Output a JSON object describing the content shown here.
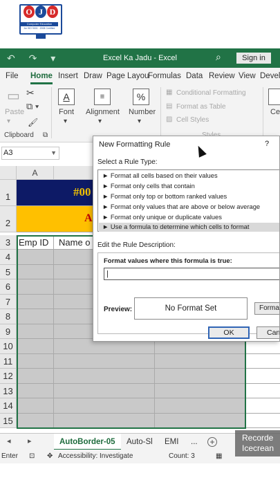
{
  "logo": {
    "letters": [
      "O",
      "J",
      "D"
    ],
    "band": "Computer Education",
    "iso": "An ISO 9001 : 2008 Certified"
  },
  "titlebar": {
    "qat": "↶ ↷ ▾",
    "title": "Excel Ka Jadu  -  Excel",
    "search_icon": "⌕",
    "signin": "Sign in"
  },
  "tabs": [
    "File",
    "Home",
    "Insert",
    "Draw",
    "Page Layou",
    "Formulas",
    "Data",
    "Review",
    "View",
    "Develo"
  ],
  "ribbon": {
    "paste": "Paste",
    "clipboard": "Clipboard",
    "font": "Font",
    "alignment": "Alignment",
    "number": "Number",
    "cond_format": "Conditional Formatting",
    "format_table": "Format as Table",
    "cell_styles": "Cell Styles",
    "styles": "Styles",
    "cells": "Cel"
  },
  "namebox": "A3",
  "grid": {
    "col_a": "A",
    "rows": [
      "1",
      "2",
      "3",
      "4",
      "5",
      "6",
      "7",
      "8",
      "9",
      "10",
      "11",
      "12",
      "13",
      "14",
      "15"
    ],
    "row1_text": "#00",
    "row2_text": "A",
    "header_emp_id": "Emp ID",
    "header_name": "Name o"
  },
  "sheets": {
    "active": "AutoBorder-05",
    "second": "Auto-Sl",
    "third": "EMI",
    "more": "...",
    "add": "+"
  },
  "status": {
    "mode": "Enter",
    "accessibility": "Accessibility: Investigate",
    "count": "Count: 3"
  },
  "watermark": {
    "line1": "Recorde",
    "line2": "Icecrean"
  },
  "dialog": {
    "title": "New Formatting Rule",
    "help": "?",
    "select_rule_type": "Select a Rule Type:",
    "rules": [
      "► Format all cells based on their values",
      "► Format only cells that contain",
      "► Format only top or bottom ranked values",
      "► Format only values that are above or below average",
      "► Format only unique or duplicate values",
      "► Use a formula to determine which cells to format"
    ],
    "edit_desc": "Edit the Rule Description:",
    "formula_label": "Format values where this formula is true:",
    "formula_value": "|",
    "preview_label": "Preview:",
    "preview_text": "No Format Set",
    "format_button": "Forma",
    "ok": "OK",
    "cancel": "Canc"
  }
}
